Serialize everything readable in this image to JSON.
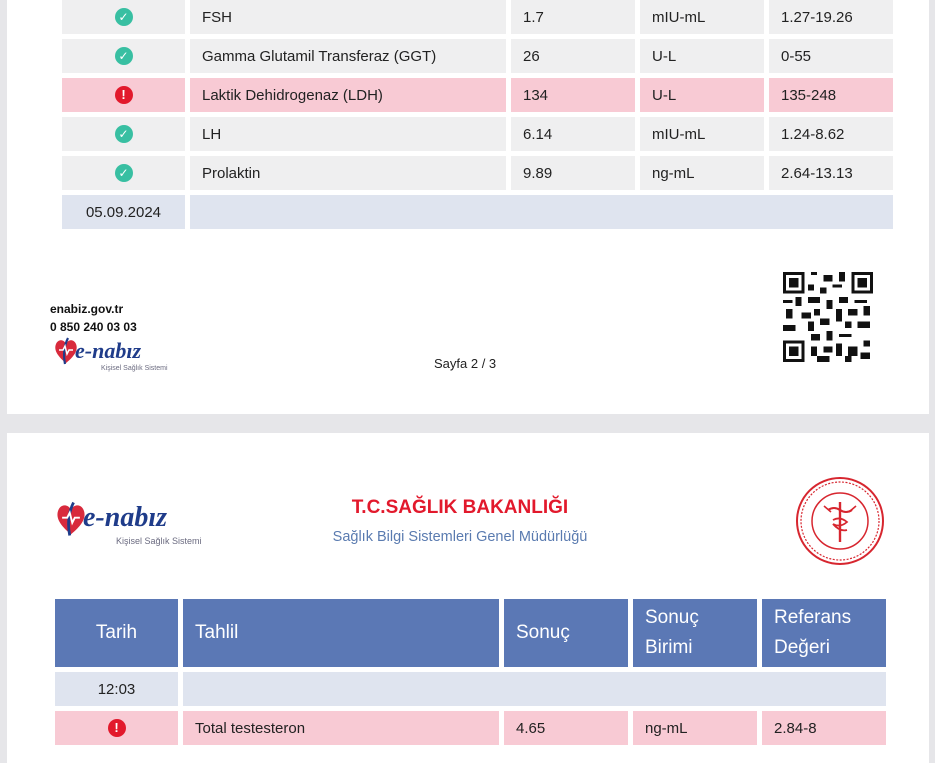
{
  "page1": {
    "rows": [
      {
        "status": "ok",
        "test": "FSH",
        "result": "1.7",
        "unit": "mIU-mL",
        "reference": "1.27-19.26"
      },
      {
        "status": "ok",
        "test": "Gamma Glutamil Transferaz (GGT)",
        "result": "26",
        "unit": "U-L",
        "reference": "0-55"
      },
      {
        "status": "abnormal",
        "test": "Laktik Dehidrogenaz (LDH)",
        "result": "134",
        "unit": "U-L",
        "reference": "135-248"
      },
      {
        "status": "ok",
        "test": "LH",
        "result": "6.14",
        "unit": "mIU-mL",
        "reference": "1.24-8.62"
      },
      {
        "status": "ok",
        "test": "Prolaktin",
        "result": "9.89",
        "unit": "ng-mL",
        "reference": "2.64-13.13"
      }
    ],
    "date_row": "05.09.2024",
    "footer": {
      "website": "enabiz.gov.tr",
      "phone": "0 850 240 03 03",
      "page_indicator": "Sayfa 2 / 3"
    }
  },
  "logo": {
    "brand": "e-nabız",
    "tagline": "Kişisel Sağlık Sistemi"
  },
  "page2": {
    "ministry_title": "T.C.SAĞLIK BAKANLIĞI",
    "ministry_subtitle": "Sağlık Bilgi Sistemleri Genel Müdürlüğü",
    "headers": {
      "date": "Tarih",
      "test": "Tahlil",
      "result": "Sonuç",
      "unit_line1": "Sonuç",
      "unit_line2": "Birimi",
      "ref_line1": "Referans",
      "ref_line2": "Değeri"
    },
    "time_row": "12:03",
    "rows": [
      {
        "status": "abnormal",
        "test": "Total testesteron",
        "result": "4.65",
        "unit": "ng-mL",
        "reference": "2.84-8"
      }
    ]
  },
  "colors": {
    "header_blue": "#5b78b5",
    "abnormal_row": "#f8cad4",
    "normal_row": "#efeff0",
    "date_row": "#dfe4ef",
    "ok_icon": "#38bfa2",
    "alert_icon": "#e2192c",
    "ministry_red": "#e2192c"
  }
}
